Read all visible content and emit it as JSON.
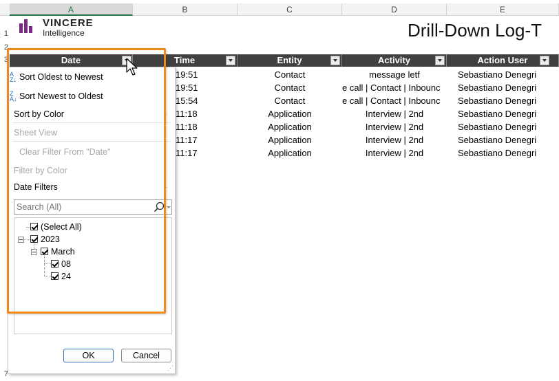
{
  "columns": {
    "a": "A",
    "b": "B",
    "c": "C",
    "d": "D",
    "e": "E"
  },
  "rows": {
    "r1": "1",
    "r2": "2",
    "r3": "3",
    "r7": "7"
  },
  "logo": {
    "name": "VINCERE",
    "sub": "Intelligence"
  },
  "report_title": "Drill-Down Log-T",
  "table": {
    "headers": {
      "date": "Date",
      "time": "Time",
      "entity": "Entity",
      "activity": "Activity",
      "action_user": "Action User"
    },
    "rows": [
      {
        "time": "19:51",
        "entity": "Contact",
        "activity": "message letf",
        "user": "Sebastiano Denegri"
      },
      {
        "time": "19:51",
        "entity": "Contact",
        "activity": "e call | Contact | Inbounc",
        "user": "Sebastiano Denegri"
      },
      {
        "time": "15:54",
        "entity": "Contact",
        "activity": "e call | Contact | Inbounc",
        "user": "Sebastiano Denegri"
      },
      {
        "time": "11:18",
        "entity": "Application",
        "activity": "Interview | 2nd",
        "user": "Sebastiano Denegri"
      },
      {
        "time": "11:18",
        "entity": "Application",
        "activity": "Interview | 2nd",
        "user": "Sebastiano Denegri"
      },
      {
        "time": "11:17",
        "entity": "Application",
        "activity": "Interview | 2nd",
        "user": "Sebastiano Denegri"
      },
      {
        "time": "11:17",
        "entity": "Application",
        "activity": "Interview | 2nd",
        "user": "Sebastiano Denegri"
      }
    ]
  },
  "filter_menu": {
    "sort_asc": "Sort Oldest to Newest",
    "sort_desc": "Sort Newest to Oldest",
    "sort_color": "Sort by Color",
    "sheet_view": "Sheet View",
    "clear_filter": "Clear Filter From \"Date\"",
    "filter_color": "Filter by Color",
    "date_filters": "Date Filters",
    "search_placeholder": "Search (All)",
    "tree": {
      "select_all": "(Select All)",
      "year": "2023",
      "month": "March",
      "days": [
        "08",
        "24"
      ]
    },
    "ok": "OK",
    "cancel": "Cancel"
  },
  "colors": {
    "highlight": "#f08a1e",
    "header_bg": "#404040",
    "brand": "#7b2a83"
  }
}
